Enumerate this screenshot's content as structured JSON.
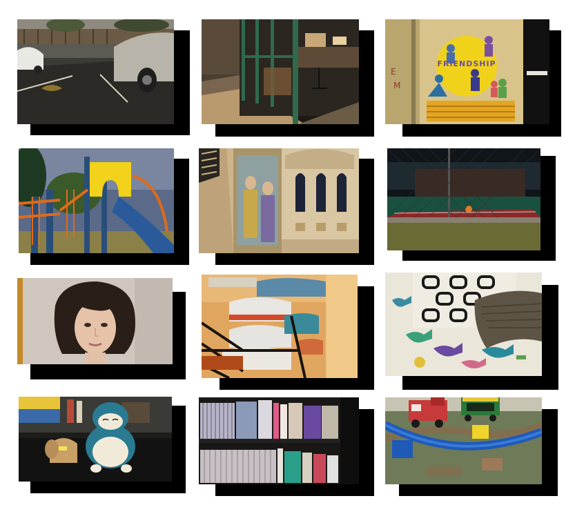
{
  "collage": {
    "background": "#ffffff",
    "shadow_color": "#000000",
    "photos": [
      {
        "id": "parking-lot",
        "subject": "parking-lot-photo"
      },
      {
        "id": "cafe-window",
        "subject": "cafe-storefront-photo"
      },
      {
        "id": "friendship-mural",
        "subject": "friendship-mural-photo",
        "sign_text": "FRIENDSHIP"
      },
      {
        "id": "playground",
        "subject": "playground-slide-photo"
      },
      {
        "id": "church-fresco",
        "subject": "church-fresco-photo"
      },
      {
        "id": "tennis-court",
        "subject": "tennis-court-photo"
      },
      {
        "id": "mannequin",
        "subject": "mannequin-head-photo"
      },
      {
        "id": "shoe-rack",
        "subject": "shoe-rack-photo"
      },
      {
        "id": "dino-bedsheet",
        "subject": "dinosaur-bedsheet-photo"
      },
      {
        "id": "snorlax-plush",
        "subject": "plush-toy-photo"
      },
      {
        "id": "bookshelf",
        "subject": "bookshelf-photo"
      },
      {
        "id": "toy-train",
        "subject": "toy-train-photo"
      }
    ]
  }
}
